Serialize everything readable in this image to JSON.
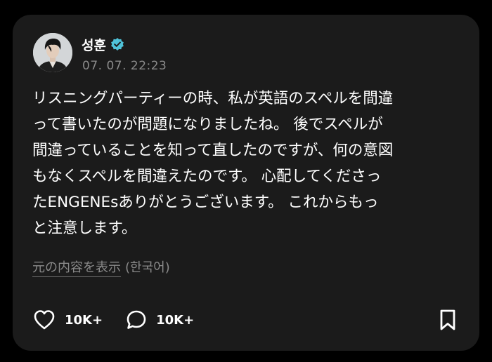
{
  "post": {
    "author": "성훈",
    "timestamp": "07. 07. 22:23",
    "body": "リスニングパーティーの時、私が英語のスペルを間違\nって書いたのが問題になりましたね。 後でスペルが\n間違っていることを知って直したのですが、何の意図\nもなくスペルを間違えたのです。 心配してくださっ\nたENGENEsありがとうございます。 これからもっ\nと注意します。",
    "translate_link": "元の内容を表示",
    "translate_lang": "(한국어)",
    "likes": "10K+",
    "comments": "10K+"
  },
  "icons": {
    "verified": "verified-badge-icon",
    "like": "heart-icon",
    "comment": "speech-bubble-icon",
    "bookmark": "bookmark-icon"
  },
  "colors": {
    "background": "#000000",
    "card": "#1b1b1b",
    "text": "#ffffff",
    "muted": "#8a8a8a",
    "verified": "#4fc3d9"
  }
}
